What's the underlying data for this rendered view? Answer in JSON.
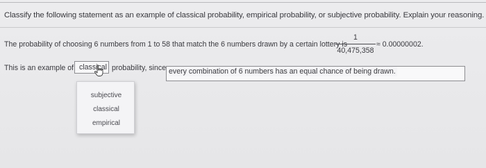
{
  "question": {
    "instructions": "Classify the following statement as an example of classical probability, empirical probability, or subjective probability. Explain your reasoning.",
    "statement": "The probability of choosing 6 numbers from 1 to 58 that match the 6 numbers drawn by a certain lottery is",
    "fraction": {
      "numerator": "1",
      "denominator": "40,475,358"
    },
    "approx": "≈ 0.00000002."
  },
  "answer": {
    "prefix": "This is an example of",
    "selected": "classical",
    "suffix": "probability, since",
    "reason": "every combination of 6 numbers has an equal chance of being drawn."
  },
  "dropdown": {
    "options": [
      "subjective",
      "classical",
      "empirical"
    ]
  },
  "colors": {
    "background": "#e9e9eb",
    "text": "#3a3a3f",
    "border": "#8c8c90"
  }
}
